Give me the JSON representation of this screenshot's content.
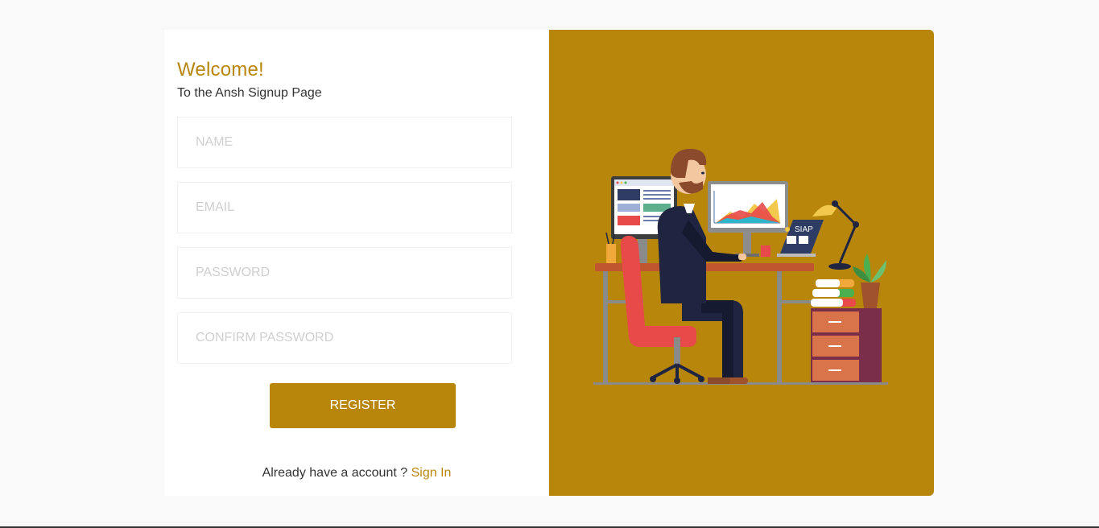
{
  "form": {
    "welcome": "Welcome!",
    "subtitle": "To the Ansh Signup Page",
    "fields": {
      "name": {
        "placeholder": "NAME",
        "value": ""
      },
      "email": {
        "placeholder": "EMAIL",
        "value": ""
      },
      "password": {
        "placeholder": "PASSWORD",
        "value": ""
      },
      "confirm": {
        "placeholder": "CONFIRM PASSWORD",
        "value": ""
      }
    },
    "register_label": "REGISTER",
    "signin_prompt": "Already have a account ?",
    "signin_link": "Sign In"
  },
  "illustration": {
    "laptop_label": "SIAP"
  },
  "colors": {
    "accent": "#b8860b",
    "background": "#f9f9f9",
    "panel": "#ffffff"
  }
}
